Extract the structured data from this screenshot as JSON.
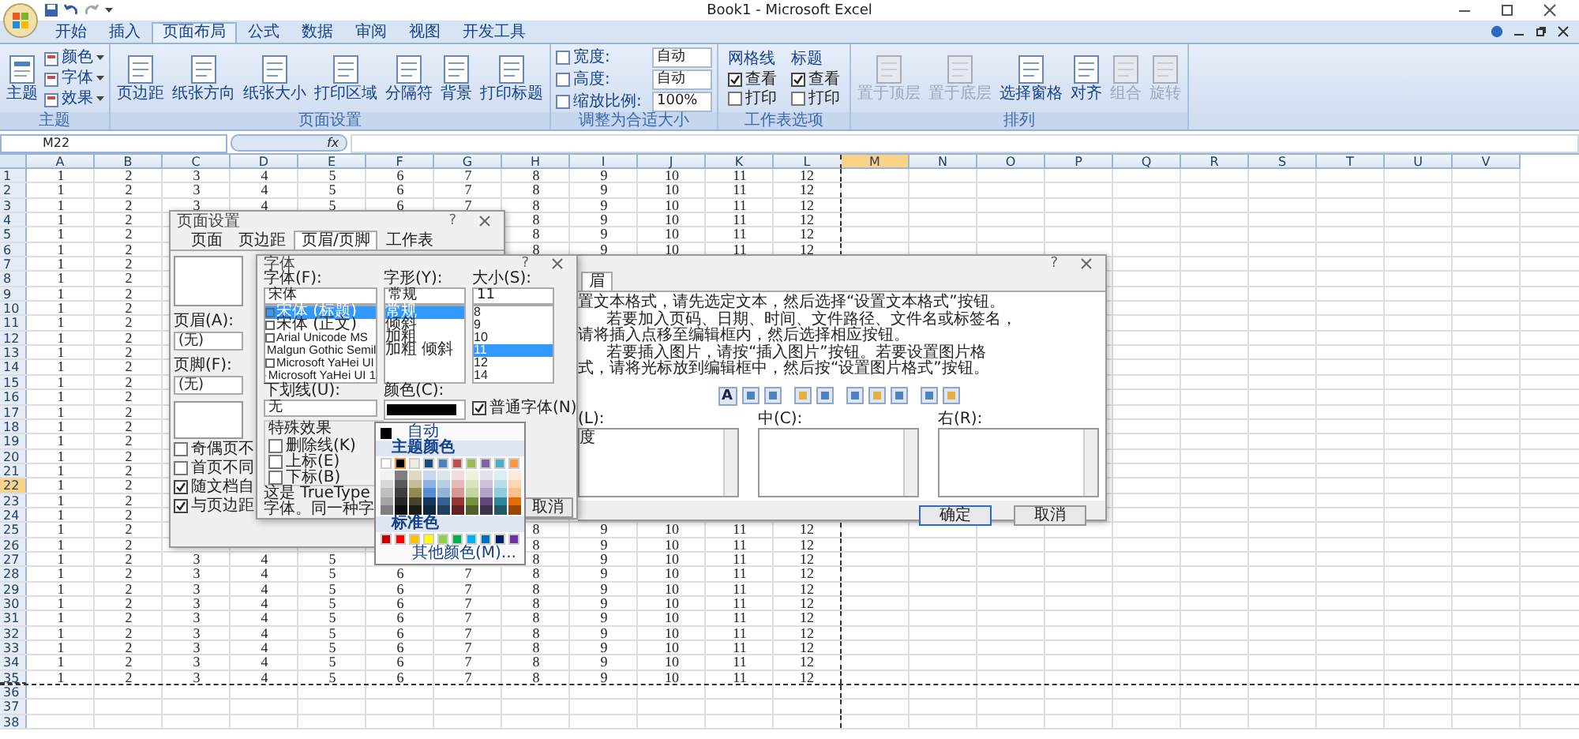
{
  "window": {
    "title": "Book1 - Microsoft Excel"
  },
  "ribbon": {
    "tabs": [
      {
        "label": "开始",
        "selected": false
      },
      {
        "label": "插入",
        "selected": false
      },
      {
        "label": "页面布局",
        "selected": true
      },
      {
        "label": "公式",
        "selected": false
      },
      {
        "label": "数据",
        "selected": false
      },
      {
        "label": "审阅",
        "selected": false
      },
      {
        "label": "视图",
        "selected": false
      },
      {
        "label": "开发工具",
        "selected": false
      }
    ],
    "groups": [
      {
        "kind": "theme",
        "label": "主题",
        "big": "主题",
        "items": [
          "颜色",
          "字体",
          "效果"
        ]
      },
      {
        "kind": "buttons",
        "label": "页面设置",
        "buttons": [
          {
            "label": "页边距",
            "disabled": false
          },
          {
            "label": "纸张方向",
            "disabled": false
          },
          {
            "label": "纸张大小",
            "disabled": false
          },
          {
            "label": "打印区域",
            "disabled": false
          },
          {
            "label": "分隔符",
            "disabled": false
          },
          {
            "label": "背景",
            "disabled": false
          },
          {
            "label": "打印标题",
            "disabled": false
          }
        ]
      },
      {
        "kind": "scale",
        "label": "调整为合适大小",
        "fields": [
          {
            "label": "宽度:",
            "value": "自动"
          },
          {
            "label": "高度:",
            "value": "自动"
          },
          {
            "label": "缩放比例:",
            "value": "100%"
          }
        ]
      },
      {
        "kind": "options",
        "label": "工作表选项",
        "columns": [
          {
            "title": "网格线",
            "options": [
              {
                "label": "查看",
                "checked": true
              },
              {
                "label": "打印",
                "checked": false
              }
            ]
          },
          {
            "title": "标题",
            "options": [
              {
                "label": "查看",
                "checked": true
              },
              {
                "label": "打印",
                "checked": false
              }
            ]
          }
        ]
      },
      {
        "kind": "buttons",
        "label": "排列",
        "buttons": [
          {
            "label": "置于顶层",
            "disabled": true
          },
          {
            "label": "置于底层",
            "disabled": true
          },
          {
            "label": "选择窗格",
            "disabled": false
          },
          {
            "label": "对齐",
            "disabled": false
          },
          {
            "label": "组合",
            "disabled": true
          },
          {
            "label": "旋转",
            "disabled": true
          }
        ]
      }
    ]
  },
  "formula_bar": {
    "name_box": "M22",
    "function_label": "fx"
  },
  "sheet": {
    "columns": [
      {
        "label": "A",
        "selected": false,
        "page_break": false
      },
      {
        "label": "B",
        "selected": false,
        "page_break": false
      },
      {
        "label": "C",
        "selected": false,
        "page_break": false
      },
      {
        "label": "D",
        "selected": false,
        "page_break": false
      },
      {
        "label": "E",
        "selected": false,
        "page_break": false
      },
      {
        "label": "F",
        "selected": false,
        "page_break": false
      },
      {
        "label": "G",
        "selected": false,
        "page_break": false
      },
      {
        "label": "H",
        "selected": false,
        "page_break": false
      },
      {
        "label": "I",
        "selected": false,
        "page_break": false
      },
      {
        "label": "J",
        "selected": false,
        "page_break": false
      },
      {
        "label": "K",
        "selected": false,
        "page_break": false
      },
      {
        "label": "L",
        "selected": false,
        "page_break": true
      },
      {
        "label": "M",
        "selected": true,
        "page_break": false
      },
      {
        "label": "N",
        "selected": false,
        "page_break": false
      },
      {
        "label": "O",
        "selected": false,
        "page_break": false
      },
      {
        "label": "P",
        "selected": false,
        "page_break": false
      },
      {
        "label": "Q",
        "selected": false,
        "page_break": false
      },
      {
        "label": "R",
        "selected": false,
        "page_break": false
      },
      {
        "label": "S",
        "selected": false,
        "page_break": false
      },
      {
        "label": "T",
        "selected": false,
        "page_break": false
      },
      {
        "label": "U",
        "selected": false,
        "page_break": false
      },
      {
        "label": "V",
        "selected": false,
        "page_break": false
      }
    ],
    "rows": [
      {
        "label": "1",
        "selected": false,
        "page_break": false,
        "cells": [
          "1",
          "2",
          "3",
          "4",
          "5",
          "6",
          "7",
          "8",
          "9",
          "10",
          "11",
          "12"
        ]
      },
      {
        "label": "2",
        "selected": false,
        "page_break": false,
        "cells": [
          "1",
          "2",
          "3",
          "4",
          "5",
          "6",
          "7",
          "8",
          "9",
          "10",
          "11",
          "12"
        ]
      },
      {
        "label": "3",
        "selected": false,
        "page_break": false,
        "cells": [
          "1",
          "2",
          "3",
          "4",
          "5",
          "6",
          "7",
          "8",
          "9",
          "10",
          "11",
          "12"
        ]
      },
      {
        "label": "4",
        "selected": false,
        "page_break": false,
        "cells": [
          "1",
          "2",
          null,
          null,
          null,
          null,
          null,
          "8",
          "9",
          "10",
          "11",
          "12"
        ]
      },
      {
        "label": "5",
        "selected": false,
        "page_break": false,
        "cells": [
          "1",
          "2",
          null,
          null,
          null,
          null,
          null,
          "8",
          "9",
          "10",
          "11",
          "12"
        ]
      },
      {
        "label": "6",
        "selected": false,
        "page_break": false,
        "cells": [
          "1",
          "2",
          null,
          null,
          null,
          null,
          null,
          "8",
          "9",
          "10",
          "11",
          "12"
        ]
      },
      {
        "label": "7",
        "selected": false,
        "page_break": false,
        "cells": [
          "1",
          "2"
        ]
      },
      {
        "label": "8",
        "selected": false,
        "page_break": false,
        "cells": [
          "1",
          "2"
        ]
      },
      {
        "label": "9",
        "selected": false,
        "page_break": false,
        "cells": [
          "1",
          "2"
        ]
      },
      {
        "label": "10",
        "selected": false,
        "page_break": false,
        "cells": [
          "1",
          "2"
        ]
      },
      {
        "label": "11",
        "selected": false,
        "page_break": false,
        "cells": [
          "1",
          "2"
        ]
      },
      {
        "label": "12",
        "selected": false,
        "page_break": false,
        "cells": [
          "1",
          "2"
        ]
      },
      {
        "label": "13",
        "selected": false,
        "page_break": false,
        "cells": [
          "1",
          "2"
        ]
      },
      {
        "label": "14",
        "selected": false,
        "page_break": false,
        "cells": [
          "1",
          "2"
        ]
      },
      {
        "label": "15",
        "selected": false,
        "page_break": false,
        "cells": [
          "1",
          "2"
        ]
      },
      {
        "label": "16",
        "selected": false,
        "page_break": false,
        "cells": [
          "1",
          "2"
        ]
      },
      {
        "label": "17",
        "selected": false,
        "page_break": false,
        "cells": [
          "1",
          "2"
        ]
      },
      {
        "label": "18",
        "selected": false,
        "page_break": false,
        "cells": [
          "1",
          "2"
        ]
      },
      {
        "label": "19",
        "selected": false,
        "page_break": false,
        "cells": [
          "1",
          "2"
        ]
      },
      {
        "label": "20",
        "selected": false,
        "page_break": false,
        "cells": [
          "1",
          "2"
        ]
      },
      {
        "label": "21",
        "selected": false,
        "page_break": false,
        "cells": [
          "1",
          "2"
        ]
      },
      {
        "label": "22",
        "selected": true,
        "page_break": false,
        "cells": [
          "1",
          "2"
        ]
      },
      {
        "label": "23",
        "selected": false,
        "page_break": false,
        "cells": [
          "1",
          "2"
        ]
      },
      {
        "label": "24",
        "selected": false,
        "page_break": false,
        "cells": [
          "1",
          "2"
        ]
      },
      {
        "label": "25",
        "selected": false,
        "page_break": false,
        "cells": [
          "1",
          "2",
          null,
          null,
          null,
          null,
          null,
          "8",
          "9",
          "10",
          "11",
          "12"
        ]
      },
      {
        "label": "26",
        "selected": false,
        "page_break": false,
        "cells": [
          "1",
          "2",
          null,
          null,
          null,
          null,
          null,
          "8",
          "9",
          "10",
          "11",
          "12"
        ]
      },
      {
        "label": "27",
        "selected": false,
        "page_break": false,
        "cells": [
          "1",
          "2",
          "3",
          "4",
          "5",
          null,
          null,
          "8",
          "9",
          "10",
          "11",
          "12"
        ]
      },
      {
        "label": "28",
        "selected": false,
        "page_break": false,
        "cells": [
          "1",
          "2",
          "3",
          "4",
          "5",
          "6",
          "7",
          "8",
          "9",
          "10",
          "11",
          "12"
        ]
      },
      {
        "label": "29",
        "selected": false,
        "page_break": false,
        "cells": [
          "1",
          "2",
          "3",
          "4",
          "5",
          "6",
          "7",
          "8",
          "9",
          "10",
          "11",
          "12"
        ]
      },
      {
        "label": "30",
        "selected": false,
        "page_break": false,
        "cells": [
          "1",
          "2",
          "3",
          "4",
          "5",
          "6",
          "7",
          "8",
          "9",
          "10",
          "11",
          "12"
        ]
      },
      {
        "label": "31",
        "selected": false,
        "page_break": false,
        "cells": [
          "1",
          "2",
          "3",
          "4",
          "5",
          "6",
          "7",
          "8",
          "9",
          "10",
          "11",
          "12"
        ]
      },
      {
        "label": "32",
        "selected": false,
        "page_break": false,
        "cells": [
          "1",
          "2",
          "3",
          "4",
          "5",
          "6",
          "7",
          "8",
          "9",
          "10",
          "11",
          "12"
        ]
      },
      {
        "label": "33",
        "selected": false,
        "page_break": false,
        "cells": [
          "1",
          "2",
          "3",
          "4",
          "5",
          "6",
          "7",
          "8",
          "9",
          "10",
          "11",
          "12"
        ]
      },
      {
        "label": "34",
        "selected": false,
        "page_break": false,
        "cells": [
          "1",
          "2",
          "3",
          "4",
          "5",
          "6",
          "7",
          "8",
          "9",
          "10",
          "11",
          "12"
        ]
      },
      {
        "label": "35",
        "selected": false,
        "page_break": true,
        "cells": [
          "1",
          "2",
          "3",
          "4",
          "5",
          "6",
          "7",
          "8",
          "9",
          "10",
          "11",
          "12"
        ]
      },
      {
        "label": "36",
        "selected": false,
        "page_break": false,
        "cells": []
      },
      {
        "label": "37",
        "selected": false,
        "page_break": false,
        "cells": []
      },
      {
        "label": "38",
        "selected": false,
        "page_break": false,
        "cells": []
      }
    ]
  },
  "header_dialog": {
    "help": "?",
    "tab": {
      "label": "眉",
      "selected": true
    },
    "instructions": [
      {
        "text": "置文本格式，请先选定文本，然后选择“设置文本格式”按钮。",
        "indent": false
      },
      {
        "text": "若要加入页码、日期、时间、文件路径、文件名或标签名，",
        "indent": true
      },
      {
        "text": "请将插入点移至编辑框内，然后选择相应按钮。",
        "indent": false
      },
      {
        "text": "若要插入图片，请按“插入图片”按钮。若要设置图片格",
        "indent": true
      },
      {
        "text": "式，请将光标放到编辑框中，然后按“设置图片格式”按钮。",
        "indent": false
      }
    ],
    "format_button": "A",
    "sections": [
      {
        "label": "(L):",
        "value": "度"
      },
      {
        "label": "中(C):"
      },
      {
        "label": "右(R):"
      }
    ],
    "buttons": [
      {
        "label": "确定",
        "default": true
      },
      {
        "label": "取消",
        "default": false
      }
    ]
  },
  "page_setup": {
    "title": "页面设置",
    "help": "?",
    "tabs": [
      {
        "label": "页面",
        "selected": false
      },
      {
        "label": "页边距",
        "selected": false
      },
      {
        "label": "页眉/页脚",
        "selected": true
      },
      {
        "label": "工作表",
        "selected": false
      }
    ],
    "header_label": "页眉(A):",
    "header_value": "(无)",
    "footer_label": "页脚(F):",
    "footer_value": "(无)",
    "options": [
      {
        "label": "奇偶页不",
        "checked": false
      },
      {
        "label": "首页不同",
        "checked": false
      },
      {
        "label": "随文档自",
        "checked": true
      },
      {
        "label": "与页边距",
        "checked": true
      }
    ]
  },
  "font_dialog": {
    "title": "字体",
    "help": "?",
    "font": {
      "label": "字体(F):",
      "value": "宋体",
      "items": [
        {
          "label": "宋体 (标题)",
          "selected": true
        },
        {
          "label": "宋体 (正文)",
          "selected": false
        },
        {
          "label": "Arial Unicode MS",
          "selected": false
        },
        {
          "label": "Malgun Gothic Semil",
          "selected": false
        },
        {
          "label": "Microsoft YaHei UI",
          "selected": false
        },
        {
          "label": "Microsoft YaHei UI 1",
          "selected": false
        }
      ]
    },
    "style": {
      "label": "字形(Y):",
      "value": "常规",
      "items": [
        {
          "label": "常规",
          "selected": true
        },
        {
          "label": "倾斜",
          "selected": false
        },
        {
          "label": "加粗",
          "selected": false
        },
        {
          "label": "加粗 倾斜",
          "selected": false
        }
      ]
    },
    "size": {
      "label": "大小(S):",
      "value": "11",
      "items": [
        {
          "label": "8",
          "selected": false
        },
        {
          "label": "9",
          "selected": false
        },
        {
          "label": "10",
          "selected": false
        },
        {
          "label": "11",
          "selected": true
        },
        {
          "label": "12",
          "selected": false
        },
        {
          "label": "14",
          "selected": false
        }
      ]
    },
    "underline": {
      "label": "下划线(U):",
      "value": "无"
    },
    "color": {
      "label": "颜色(C):",
      "color": "#000000"
    },
    "normal_font": {
      "label": "普通字体(N)",
      "checked": true
    },
    "effects": {
      "title": "特殊效果",
      "items": [
        {
          "label": "删除线(K)",
          "checked": false
        },
        {
          "label": "上标(E)",
          "checked": false
        },
        {
          "label": "下标(B)",
          "checked": false
        }
      ]
    },
    "note": "这是 TrueType 字体。同一种字",
    "cancel": "取消"
  },
  "color_menu": {
    "auto": "自动",
    "theme_title": "主题颜色",
    "theme": [
      {
        "color": "#ffffff",
        "selected": false,
        "shades": [
          {
            "color": "#f2f2f2"
          },
          {
            "color": "#d8d8d8"
          },
          {
            "color": "#bfbfbf"
          },
          {
            "color": "#a5a5a5"
          },
          {
            "color": "#7f7f7f"
          }
        ]
      },
      {
        "color": "#000000",
        "selected": true,
        "shades": [
          {
            "color": "#7f7f7f"
          },
          {
            "color": "#595959"
          },
          {
            "color": "#3f3f3f"
          },
          {
            "color": "#262626"
          },
          {
            "color": "#0c0c0c"
          }
        ]
      },
      {
        "color": "#eeece1",
        "selected": false,
        "shades": [
          {
            "color": "#ddd9c3"
          },
          {
            "color": "#c4bd97"
          },
          {
            "color": "#938953"
          },
          {
            "color": "#494429"
          },
          {
            "color": "#1d1b10"
          }
        ]
      },
      {
        "color": "#1f497d",
        "selected": false,
        "shades": [
          {
            "color": "#c6d9f0"
          },
          {
            "color": "#8db3e2"
          },
          {
            "color": "#548dd4"
          },
          {
            "color": "#17365d"
          },
          {
            "color": "#0f243e"
          }
        ]
      },
      {
        "color": "#4f81bd",
        "selected": false,
        "shades": [
          {
            "color": "#dbe5f1"
          },
          {
            "color": "#b8cce4"
          },
          {
            "color": "#95b3d7"
          },
          {
            "color": "#366092"
          },
          {
            "color": "#244061"
          }
        ]
      },
      {
        "color": "#c0504d",
        "selected": false,
        "shades": [
          {
            "color": "#f2dcdb"
          },
          {
            "color": "#e5b9b7"
          },
          {
            "color": "#d99694"
          },
          {
            "color": "#953734"
          },
          {
            "color": "#632423"
          }
        ]
      },
      {
        "color": "#9bbb59",
        "selected": false,
        "shades": [
          {
            "color": "#ebf1dd"
          },
          {
            "color": "#d7e3bc"
          },
          {
            "color": "#c3d69b"
          },
          {
            "color": "#76923c"
          },
          {
            "color": "#4f6128"
          }
        ]
      },
      {
        "color": "#8064a2",
        "selected": false,
        "shades": [
          {
            "color": "#e5e0ec"
          },
          {
            "color": "#ccc1d9"
          },
          {
            "color": "#b2a2c7"
          },
          {
            "color": "#5f497a"
          },
          {
            "color": "#3f3151"
          }
        ]
      },
      {
        "color": "#4bacc6",
        "selected": false,
        "shades": [
          {
            "color": "#dbeef3"
          },
          {
            "color": "#b7dde8"
          },
          {
            "color": "#92cddc"
          },
          {
            "color": "#31859b"
          },
          {
            "color": "#205867"
          }
        ]
      },
      {
        "color": "#f79646",
        "selected": false,
        "shades": [
          {
            "color": "#fdeada"
          },
          {
            "color": "#fbd5b5"
          },
          {
            "color": "#fac08f"
          },
          {
            "color": "#e36c09"
          },
          {
            "color": "#974806"
          }
        ]
      }
    ],
    "standard_title": "标准色",
    "standard": [
      {
        "color": "#c00000"
      },
      {
        "color": "#ff0000"
      },
      {
        "color": "#ffc000"
      },
      {
        "color": "#ffff00"
      },
      {
        "color": "#92d050"
      },
      {
        "color": "#00b050"
      },
      {
        "color": "#00b0f0"
      },
      {
        "color": "#0070c0"
      },
      {
        "color": "#002060"
      },
      {
        "color": "#7030a0"
      }
    ],
    "more": "其他颜色(M)..."
  }
}
